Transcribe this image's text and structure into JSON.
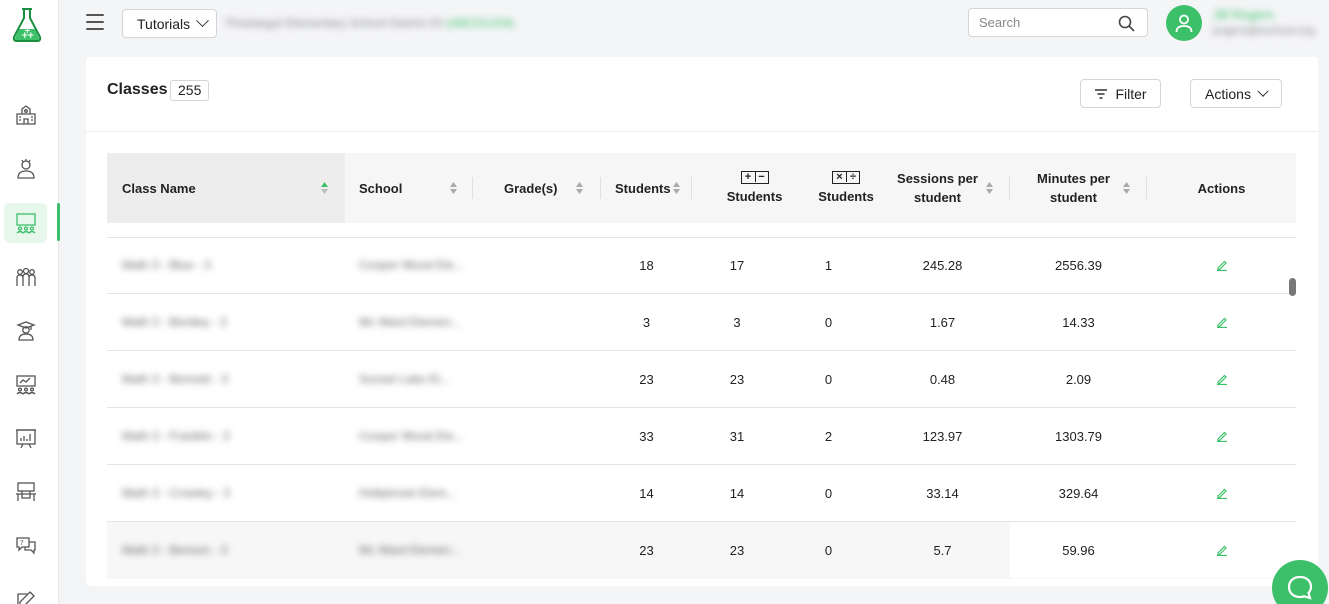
{
  "topbar": {
    "tutorials_label": "Tutorials",
    "school_name": "Pinelaegol Elementary School District 03",
    "school_suffix": "(ABCD1234)",
    "search_placeholder": "Search",
    "user_name": "Jill Rogers",
    "user_email": "jrogers@eschool.org"
  },
  "sidebar": {
    "items": [
      {
        "name": "school-icon"
      },
      {
        "name": "teacher-icon"
      },
      {
        "name": "classes-icon",
        "active": true
      },
      {
        "name": "students-icon"
      },
      {
        "name": "graduate-icon"
      },
      {
        "name": "classroom-icon"
      },
      {
        "name": "reports-icon"
      },
      {
        "name": "desk-icon"
      },
      {
        "name": "support-icon"
      },
      {
        "name": "edit-icon"
      }
    ]
  },
  "card": {
    "title": "Classes",
    "count": "255",
    "filter_label": "Filter",
    "actions_label": "Actions"
  },
  "table": {
    "columns": {
      "class_name": "Class Name",
      "school": "School",
      "grades": "Grade(s)",
      "students": "Students",
      "addsub_students": "Students",
      "muldiv_students": "Students",
      "sessions_line1": "Sessions per",
      "sessions_line2": "student",
      "minutes_line1": "Minutes per",
      "minutes_line2": "student",
      "actions": "Actions"
    },
    "rows": [
      {
        "class_name": "Math 3 - Blue - 3",
        "school": "Cooper Wood Ele...",
        "grades": "",
        "students": "18",
        "addsub": "17",
        "muldiv": "1",
        "sessions": "245.28",
        "minutes": "2556.39"
      },
      {
        "class_name": "Math 3 - Bentley - 3",
        "school": "Mc Ward Elemen...",
        "grades": "",
        "students": "3",
        "addsub": "3",
        "muldiv": "0",
        "sessions": "1.67",
        "minutes": "14.33"
      },
      {
        "class_name": "Math 3 - Bennett - 3",
        "school": "Sunset Lake El...",
        "grades": "",
        "students": "23",
        "addsub": "23",
        "muldiv": "0",
        "sessions": "0.48",
        "minutes": "2.09"
      },
      {
        "class_name": "Math 3 - Franklin - 3",
        "school": "Cooper Wood Ele...",
        "grades": "",
        "students": "33",
        "addsub": "31",
        "muldiv": "2",
        "sessions": "123.97",
        "minutes": "1303.79"
      },
      {
        "class_name": "Math 3 - Crowley - 3",
        "school": "Hollybrook Elem...",
        "grades": "",
        "students": "14",
        "addsub": "14",
        "muldiv": "0",
        "sessions": "33.14",
        "minutes": "329.64"
      },
      {
        "class_name": "Math 3 - Benson - 3",
        "school": "Mc Ward Elemen...",
        "grades": "",
        "students": "23",
        "addsub": "23",
        "muldiv": "0",
        "sessions": "5.7",
        "minutes": "59.96"
      }
    ]
  },
  "colors": {
    "accent": "#3cc06a",
    "active_bg": "#e7f7ec"
  }
}
